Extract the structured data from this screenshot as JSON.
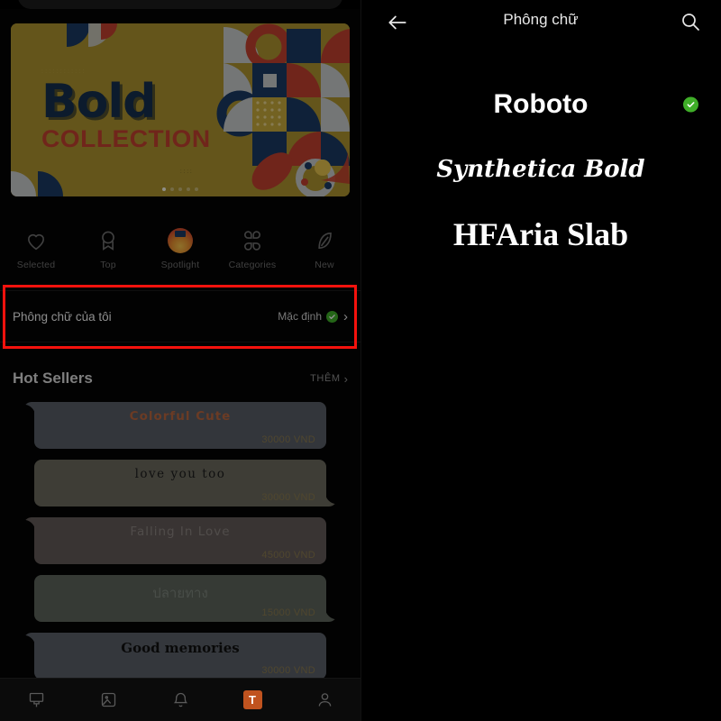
{
  "left_panel": {
    "banner": {
      "title": "Bold",
      "subtitle": "COLLECTION",
      "dots_deco": "::::::::::::",
      "dots_deco2": "::::",
      "bg_color": "#ac9330",
      "title_color": "#152f4e",
      "subtitle_color": "#c2402f",
      "pager_count": 5,
      "pager_active": 1
    },
    "categories": [
      {
        "label": "Selected",
        "icon": "heart-icon"
      },
      {
        "label": "Top",
        "icon": "ribbon-icon"
      },
      {
        "label": "Spotlight",
        "icon": "spotlight-avatar-icon"
      },
      {
        "label": "Categories",
        "icon": "clover-grid-icon"
      },
      {
        "label": "New",
        "icon": "leaf-icon"
      }
    ],
    "my_font_row": {
      "label": "Phông chữ của tôi",
      "value": "Mặc định",
      "check_icon": "green-check-icon",
      "chevron": "›",
      "highlight_color": "#f4120d"
    },
    "section": {
      "title": "Hot Sellers",
      "more_label": "THÊM",
      "more_chevron": "›"
    },
    "cards": [
      {
        "name": "Colorful Cute",
        "price": "30000 VND",
        "bg": "#585d66",
        "name_color": "#b8663f",
        "tail": "left"
      },
      {
        "name": "love you too",
        "price": "30000 VND",
        "bg": "#6b6a5e",
        "name_color": "#1c1c1c",
        "tail": "right"
      },
      {
        "name": "Falling In Love",
        "price": "45000 VND",
        "bg": "#635a58",
        "name_color": "#8b8480",
        "tail": "left"
      },
      {
        "name": "ปลายทาง",
        "price": "15000 VND",
        "bg": "#5d645c",
        "name_color": "#7d857c",
        "tail": "right"
      },
      {
        "name": "Good memories",
        "price": "30000 VND",
        "bg": "#5a6068",
        "name_color": "#111111",
        "tail": "left"
      }
    ],
    "bottom_nav": [
      {
        "icon": "brush-icon",
        "label": "",
        "active": false
      },
      {
        "icon": "image-icon",
        "label": "",
        "active": false
      },
      {
        "icon": "bell-icon",
        "label": "",
        "active": false
      },
      {
        "icon": "text-t-icon",
        "label": "T",
        "active": true,
        "active_color": "#c0531f"
      },
      {
        "icon": "person-icon",
        "label": "",
        "active": false
      }
    ]
  },
  "right_panel": {
    "header": {
      "title": "Phông chữ",
      "back_icon": "back-arrow-icon",
      "search_icon": "search-icon"
    },
    "fonts": [
      {
        "name": "Roboto",
        "selected": true,
        "style": "fn-roboto"
      },
      {
        "name": "Synthetica Bold",
        "selected": false,
        "style": "fn-script"
      },
      {
        "name": "HFAria Slab",
        "selected": false,
        "style": "fn-slab"
      }
    ]
  },
  "colors": {
    "accent_green": "#3fae28",
    "accent_orange": "#c0531f",
    "highlight_red": "#f4120d",
    "background": "#000000"
  }
}
